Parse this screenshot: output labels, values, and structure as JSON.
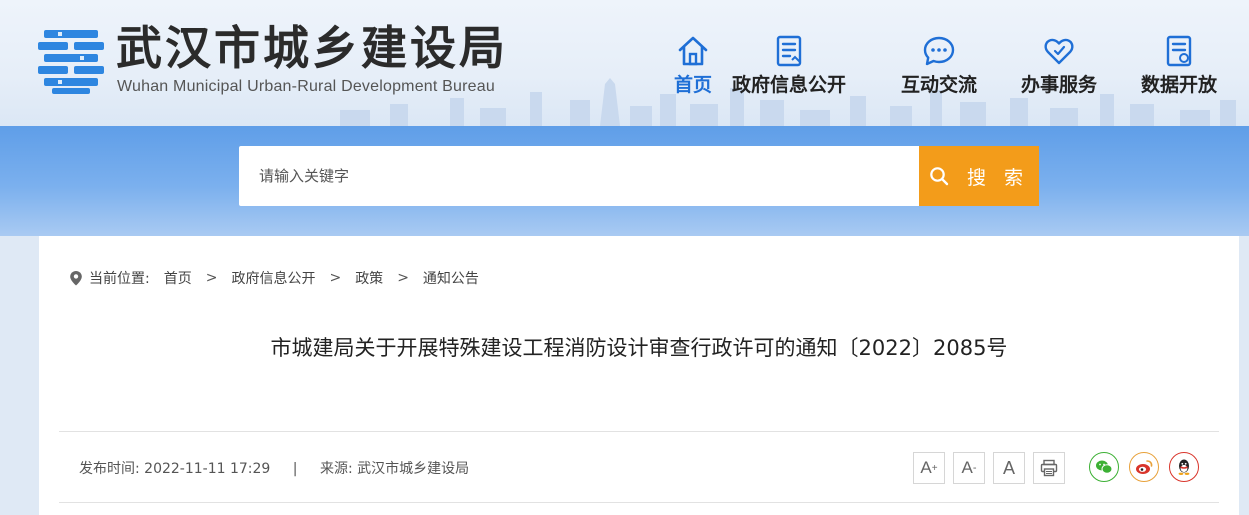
{
  "header": {
    "site_name_cn": "武汉市城乡建设局",
    "site_name_en": "Wuhan Municipal Urban-Rural Development Bureau"
  },
  "nav": {
    "items": [
      {
        "label": "首页",
        "icon": "home-icon",
        "active": true
      },
      {
        "label": "政府信息公开",
        "icon": "document-list-icon",
        "active": false
      },
      {
        "label": "互动交流",
        "icon": "chat-bubble-icon",
        "active": false
      },
      {
        "label": "办事服务",
        "icon": "heart-hand-icon",
        "active": false
      },
      {
        "label": "数据开放",
        "icon": "data-document-icon",
        "active": false
      }
    ]
  },
  "search": {
    "placeholder": "请输入关键字",
    "button_label": "搜 索"
  },
  "breadcrumb": {
    "lead": "当前位置:",
    "items": [
      "首页",
      "政府信息公开",
      "政策",
      "通知公告"
    ],
    "separator": ">"
  },
  "article": {
    "title": "市城建局关于开展特殊建设工程消防设计审查行政许可的通知〔2022〕2085号",
    "publish_label": "发布时间:",
    "publish_time": "2022-11-11 17:29",
    "meta_divider": "|",
    "source_label": "来源:",
    "source": "武汉市城乡建设局"
  },
  "tools": {
    "font_large": "A",
    "font_large_mark": "+",
    "font_small": "A",
    "font_small_mark": "-",
    "font_normal": "A"
  },
  "colors": {
    "accent_blue": "#1f6fd6",
    "search_orange": "#f39c1a",
    "wechat_green": "#3cb034",
    "weibo_orange": "#e8a13a",
    "qq_red": "#d9352b"
  }
}
